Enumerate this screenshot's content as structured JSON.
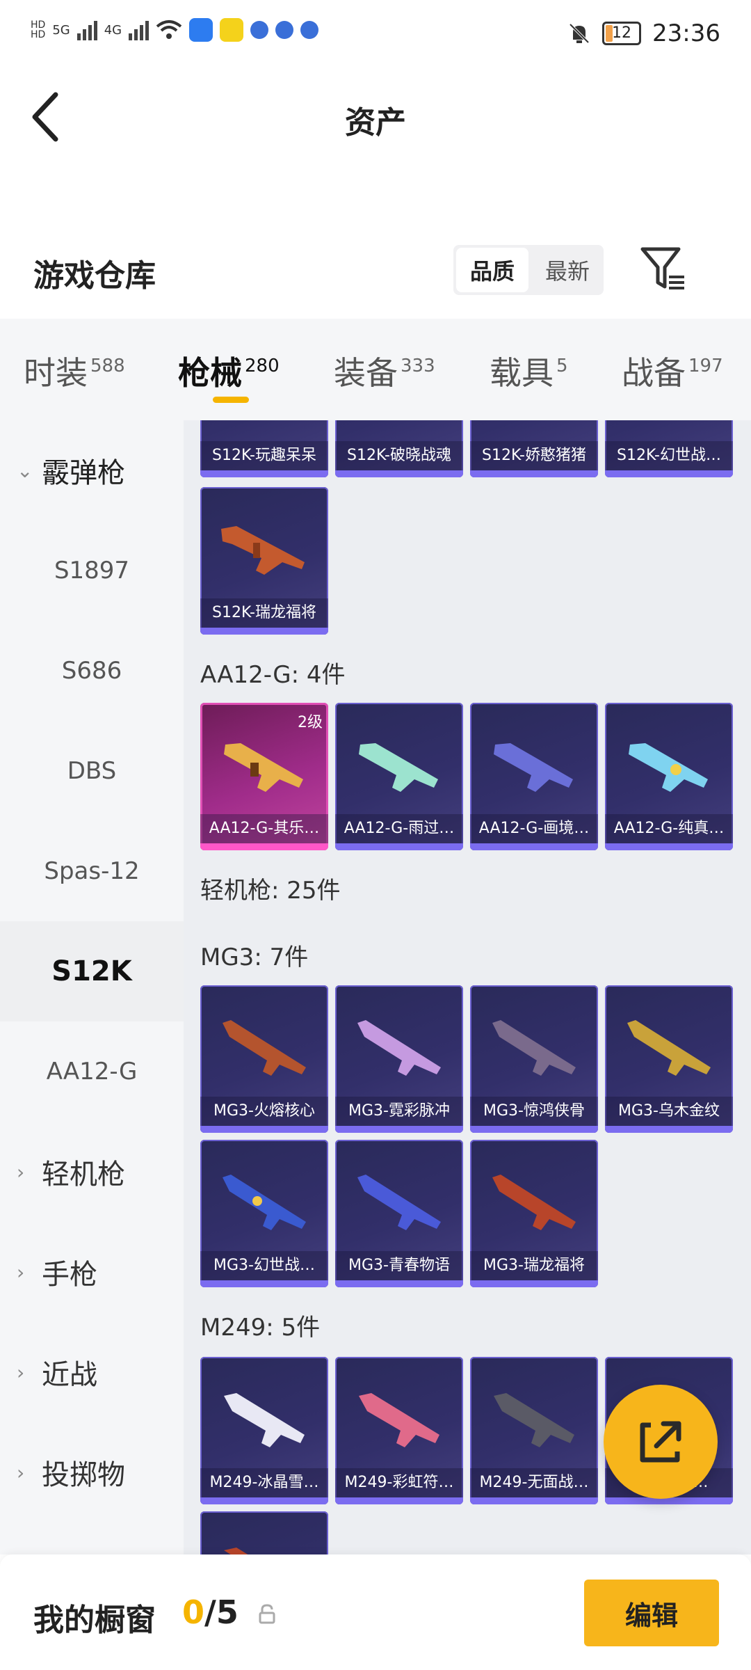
{
  "status_bar": {
    "time": "23:36",
    "battery": "12",
    "net1": "5G",
    "net2": "4G"
  },
  "header": {
    "title": "资产"
  },
  "warehouse": {
    "title": "游戏仓库",
    "sort": [
      "品质",
      "最新"
    ]
  },
  "tabs": [
    {
      "label": "时装",
      "count": "588"
    },
    {
      "label": "枪械",
      "count": "280"
    },
    {
      "label": "装备",
      "count": "333"
    },
    {
      "label": "载具",
      "count": "5"
    },
    {
      "label": "战备",
      "count": "197"
    }
  ],
  "sidebar": {
    "items": [
      {
        "label": "霰弹枪"
      },
      {
        "label": "S1897"
      },
      {
        "label": "S686"
      },
      {
        "label": "DBS"
      },
      {
        "label": "Spas-12"
      },
      {
        "label": "S12K"
      },
      {
        "label": "AA12-G"
      },
      {
        "label": "轻机枪"
      },
      {
        "label": "手枪"
      },
      {
        "label": "近战"
      },
      {
        "label": "投掷物"
      }
    ]
  },
  "content": {
    "s12k_top": [
      "S12K-玩趣呆呆",
      "S12K-破晓战魂",
      "S12K-娇憨猪猪",
      "S12K-幻世战…"
    ],
    "s12k_more": [
      "S12K-瑞龙福将"
    ],
    "aa12_heading": "AA12-G: 4件",
    "aa12": [
      "AA12-G-其乐…",
      "AA12-G-雨过…",
      "AA12-G-画境…",
      "AA12-G-纯真…"
    ],
    "aa12_level": "2级",
    "lmg_heading": "轻机枪: 25件",
    "mg3_heading": "MG3: 7件",
    "mg3": [
      "MG3-火熔核心",
      "MG3-霓彩脉冲",
      "MG3-惊鸿侠骨",
      "MG3-乌木金纹",
      "MG3-幻世战…",
      "MG3-青春物语",
      "MG3-瑞龙福将"
    ],
    "m249_heading": "M249: 5件",
    "m249": [
      "M249-冰晶雪…",
      "M249-彩虹符…",
      "M249-无面战…",
      "M249-青…"
    ]
  },
  "showcase": {
    "label": "我的橱窗",
    "count": "0",
    "total": "/5",
    "edit": "编辑"
  },
  "colors": {
    "accent": "#f7b51b",
    "card_bg": "#322f6a",
    "card_border": "#7b6cf0",
    "gold_card": "#a02c8a"
  }
}
